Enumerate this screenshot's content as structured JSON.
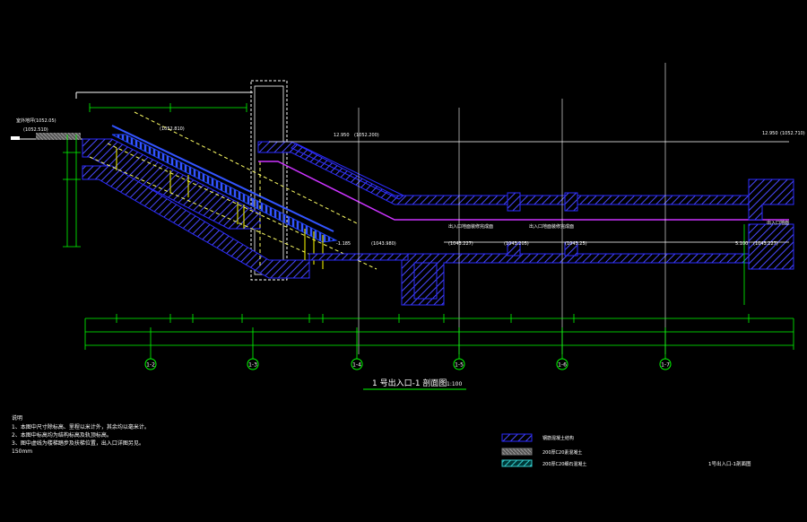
{
  "drawing": {
    "title_main": "1 号出入口-1 剖面图",
    "title_scale": "1:100",
    "sheet_label": "1号出入口-1剖面图"
  },
  "notes": {
    "heading": "说明",
    "items": [
      "1、本图中尺寸除标高、里程以米计外，其余均以毫米计。",
      "2、本图中标高均为结构标高及轨顶标高。",
      "3、图中虚线为楼梯踏步及扶梯位置，出入口详图另见。"
    ],
    "extra": "150mm"
  },
  "legend": [
    {
      "label": "钢筋混凝土结构",
      "swatch": "blue-hatch"
    },
    {
      "label": "200厚C20素混凝土",
      "swatch": "gray-hatch"
    },
    {
      "label": "200厚C20细石混凝土",
      "swatch": "cyan-hatch"
    }
  ],
  "levels": {
    "ground_left_a": "室外地坪(1052.05)",
    "ground_left_b": "(1052.510)",
    "top_mid": "12.950",
    "top_mid_b": "(1052.200)",
    "top_right": "12.950",
    "top_right_b": "(1052.710)",
    "stair_top": "(1052.810)",
    "lower_a": "-1.185",
    "lower_b": "(1043.980)",
    "lower_c": "(1043.227)",
    "lower_d": "(1043.205)",
    "lower_e": "(1043.25)",
    "right_end": "5.100",
    "right_end_b": "(1043.227)",
    "annot_a": "出入口地面装修完成面",
    "annot_b": "出入口地面装修完成面",
    "annot_c": "出入口地面"
  },
  "axes": [
    "1-2",
    "1-3",
    "1-4",
    "1-5",
    "1-6",
    "1-7"
  ],
  "colors": {
    "background": "#000000",
    "structure": "#2b2bff",
    "hatch": "#4a4aff",
    "dimension": "#00ff00",
    "stair_fill": "#1f3cff",
    "railing": "#ffff00",
    "purple": "#cc33ff",
    "cad_white": "#ffffff",
    "dashed": "#ffff66"
  }
}
